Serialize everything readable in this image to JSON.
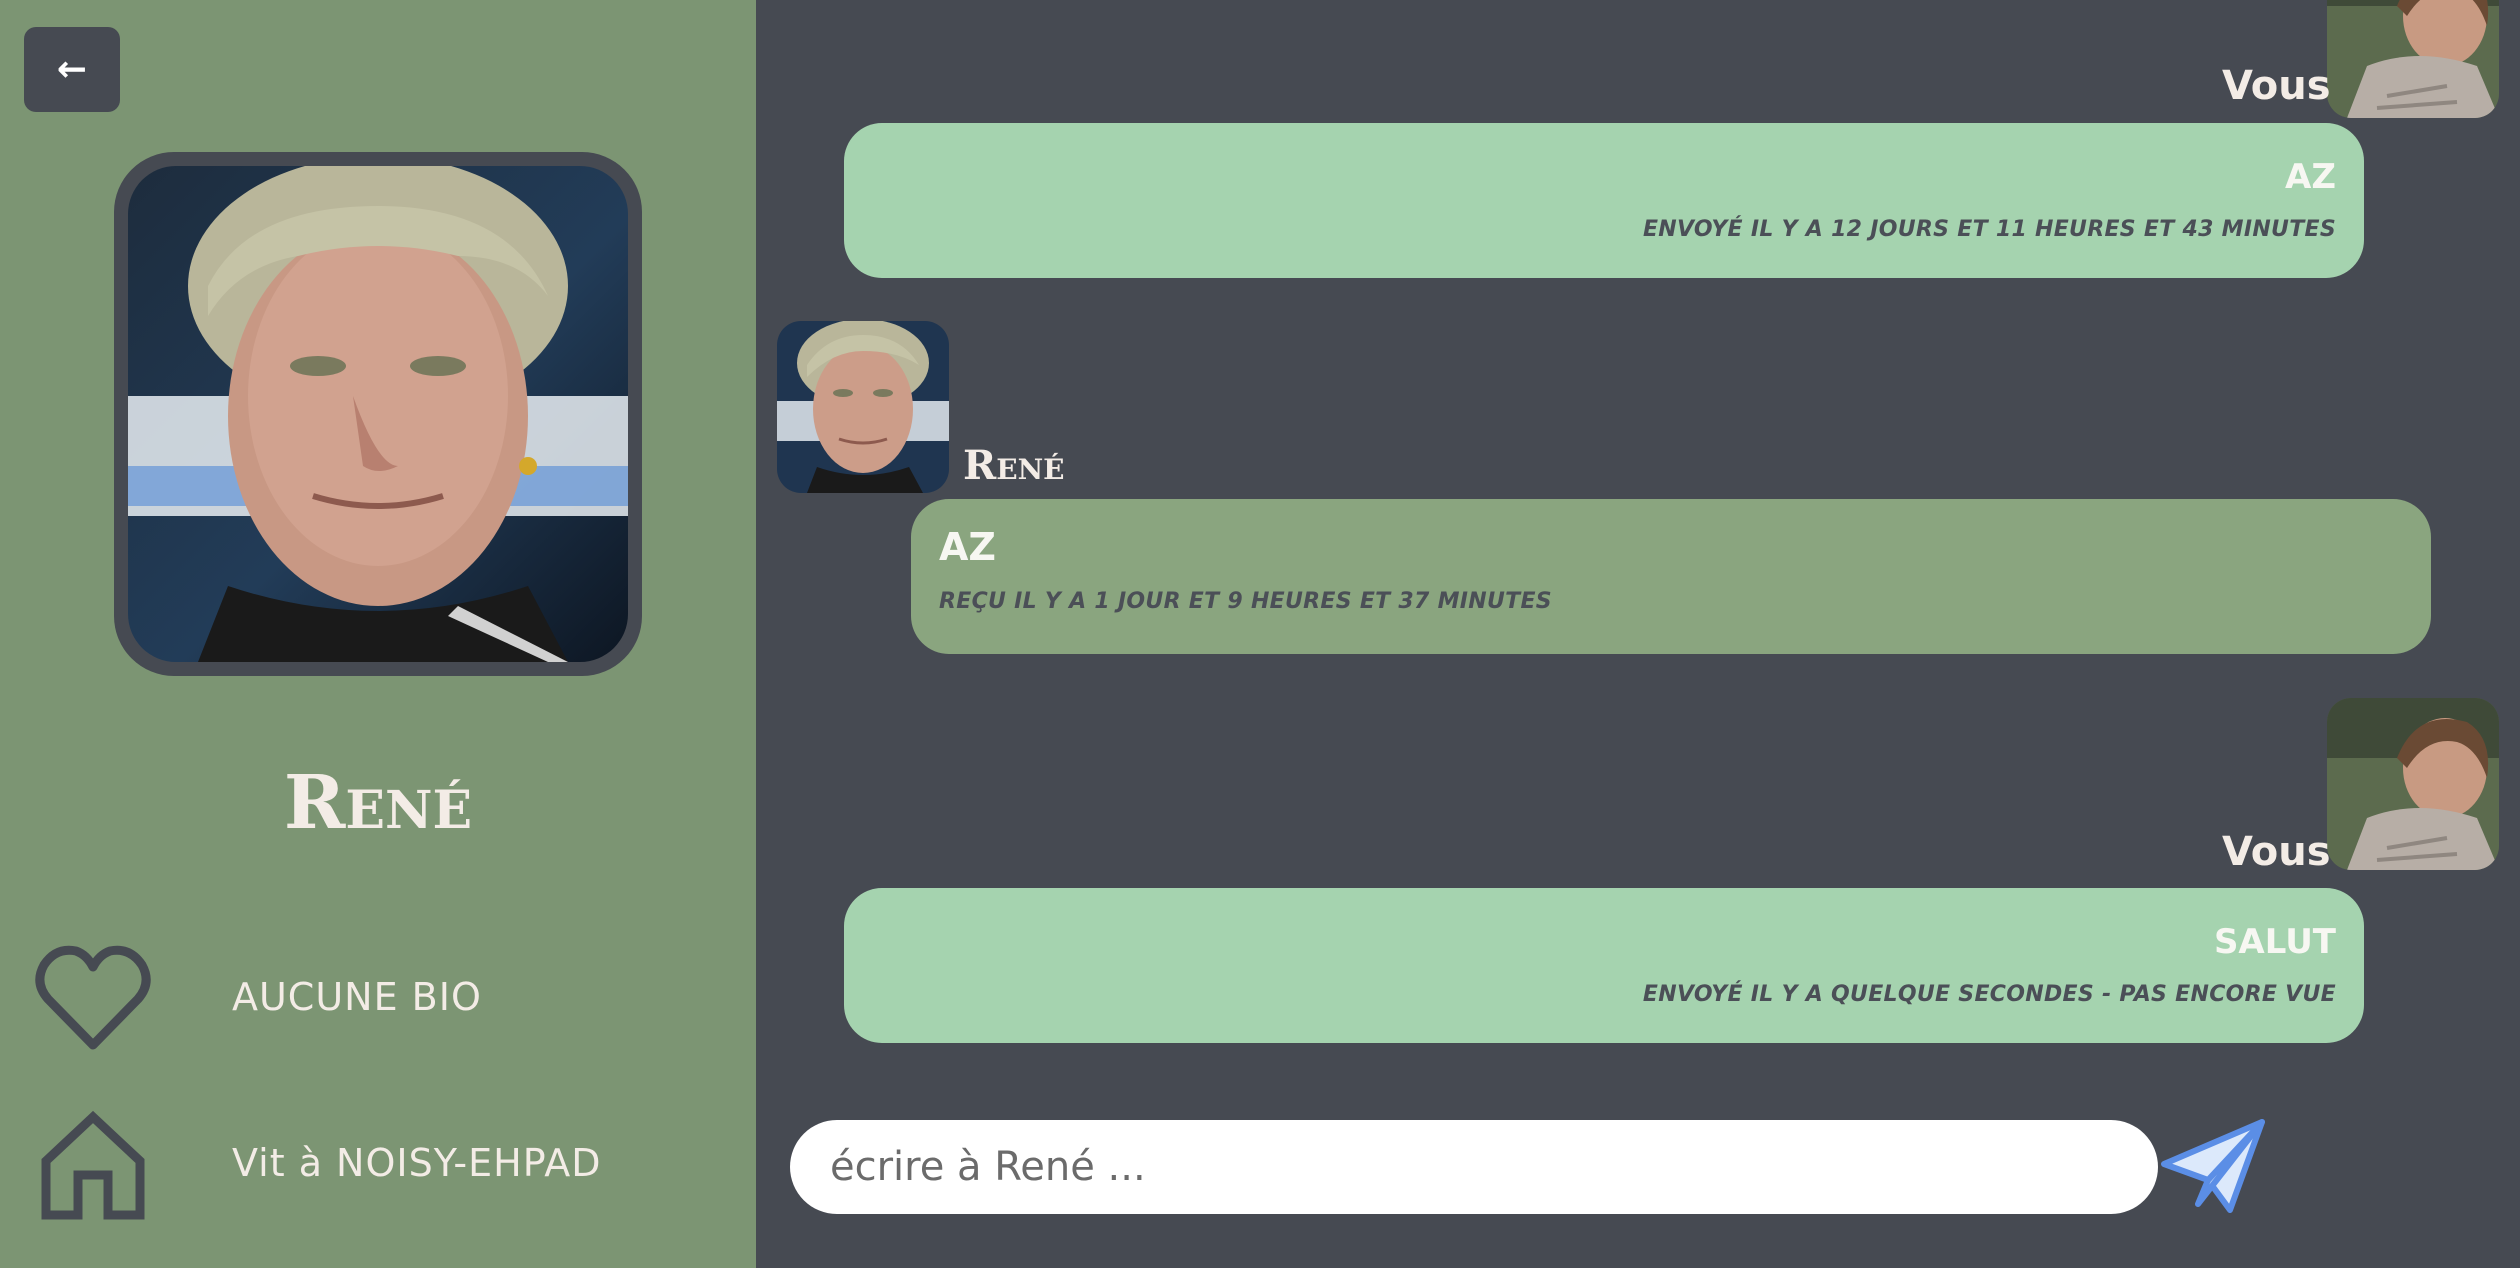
{
  "sidebar": {
    "back_label": "←",
    "name": "René",
    "bio": "AUCUNE BIO",
    "lives_in": "Vit à NOISY-EHPAD"
  },
  "messages": [
    {
      "author": "Vous",
      "text": "AZ",
      "meta": "ENVOYÉ IL Y A 12 JOURS ET 11 HEURES ET 43 MINUTES",
      "direction": "sent"
    },
    {
      "author": "René",
      "text": "AZ",
      "meta": "REÇU IL Y A 1 JOUR ET 9 HEURES ET 37 MINUTES",
      "direction": "received"
    },
    {
      "author": "Vous",
      "text": "SALUT",
      "meta": "ENVOYÉ IL Y A QUELQUE SECONDES - PAS ENCORE VUE",
      "direction": "sent"
    }
  ],
  "compose": {
    "placeholder": "écrire à René ..."
  },
  "icons": {
    "back": "arrow-left-icon",
    "bio": "heart-icon",
    "home": "house-icon",
    "send": "paper-plane-icon"
  },
  "colors": {
    "sidebar": "#7c9573",
    "chat_background": "#464a52",
    "sent_bubble": "#a5d3af",
    "received_bubble": "#8aa57f",
    "send_icon": "#5b8ee6"
  }
}
